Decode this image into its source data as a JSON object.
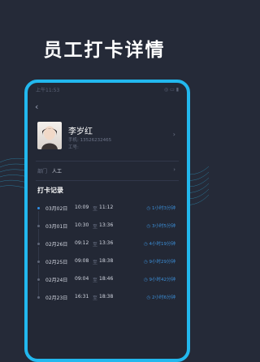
{
  "headline": "员工打卡详情",
  "status": {
    "time": "上午11:53",
    "icons": "◎ ▭ ▮"
  },
  "back_icon": "chevron-left-icon",
  "employee": {
    "name": "李岁红",
    "phone": "手机: 13526232465",
    "id_label": "工号:"
  },
  "department": {
    "label": "部门",
    "value": "人工"
  },
  "section_title": "打卡记录",
  "records": [
    {
      "date": "03月02日",
      "in": "10:09",
      "to": "至",
      "out": "11:12",
      "duration": "1小时3分钟"
    },
    {
      "date": "03月01日",
      "in": "10:30",
      "to": "至",
      "out": "13:36",
      "duration": "3小时5分钟"
    },
    {
      "date": "02月26日",
      "in": "09:12",
      "to": "至",
      "out": "13:36",
      "duration": "4小时19分钟"
    },
    {
      "date": "02月25日",
      "in": "09:08",
      "to": "至",
      "out": "18:38",
      "duration": "9小时29分钟"
    },
    {
      "date": "02月24日",
      "in": "09:04",
      "to": "至",
      "out": "18:46",
      "duration": "9小时42分钟"
    },
    {
      "date": "02月23日",
      "in": "16:31",
      "to": "至",
      "out": "18:38",
      "duration": "2小时6分钟"
    }
  ],
  "colors": {
    "accent": "#22b8ee",
    "duration": "#3b8fd8",
    "background": "#252a38"
  }
}
